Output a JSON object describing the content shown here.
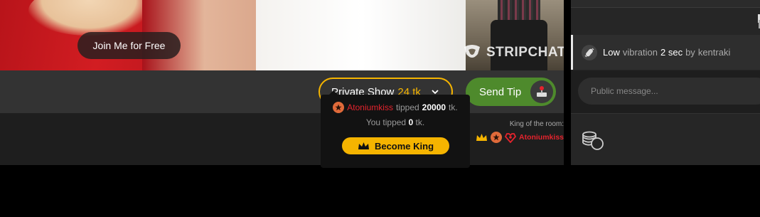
{
  "video": {
    "join_label": "Join Me for Free",
    "logo_text": "STRIPCHAT"
  },
  "controls": {
    "private_show_label": "Private Show",
    "private_show_price": "24 tk",
    "send_tip_label": "Send Tip"
  },
  "king": {
    "title": "King of the room:",
    "name": "Atoniumkiss"
  },
  "popover": {
    "tipper": "Atoniumkiss",
    "tipped_word": "tipped",
    "amount": "20000",
    "unit": "tk.",
    "you_tipped_prefix": "You tipped",
    "you_tipped_amount": "0",
    "you_tipped_unit": "tk.",
    "become_king_label": "Become King"
  },
  "chat": {
    "message": {
      "level": "Low",
      "vibration_word": "vibration",
      "duration": "2 sec",
      "by_word": "by",
      "user": "kentraki"
    },
    "input_placeholder": "Public message..."
  },
  "colors": {
    "accent_yellow": "#f5b400",
    "tip_green": "#4e8a2c",
    "username_red": "#e5232d"
  },
  "icons": [
    "chevron-down-icon",
    "joystick-icon",
    "crown-icon",
    "star-badge-icon",
    "heart-gem-icon",
    "vibration-icon",
    "coins-icon"
  ]
}
